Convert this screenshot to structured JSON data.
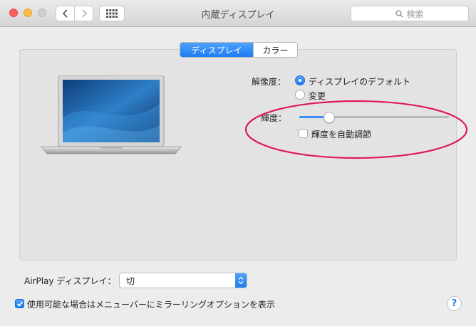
{
  "window": {
    "title": "内蔵ディスプレイ"
  },
  "toolbar": {
    "search_placeholder": "検索"
  },
  "tabs": [
    {
      "label": "ディスプレイ",
      "active": true
    },
    {
      "label": "カラー",
      "active": false
    }
  ],
  "display": {
    "resolution_label": "解像度：",
    "resolution_options": [
      {
        "label": "ディスプレイのデフォルト",
        "selected": true
      },
      {
        "label": "変更",
        "selected": false
      }
    ],
    "brightness_label": "輝度：",
    "brightness_value": 0.2,
    "auto_brightness_label": "輝度を自動調節",
    "auto_brightness_checked": false
  },
  "airplay": {
    "label": "AirPlay ディスプレイ：",
    "selected": "切"
  },
  "mirroring": {
    "label": "使用可能な場合はメニューバーにミラーリングオプションを表示",
    "checked": true
  },
  "help": {
    "label": "?"
  },
  "colors": {
    "accent": "#1d7cf2",
    "annotation": "#e0185a"
  }
}
